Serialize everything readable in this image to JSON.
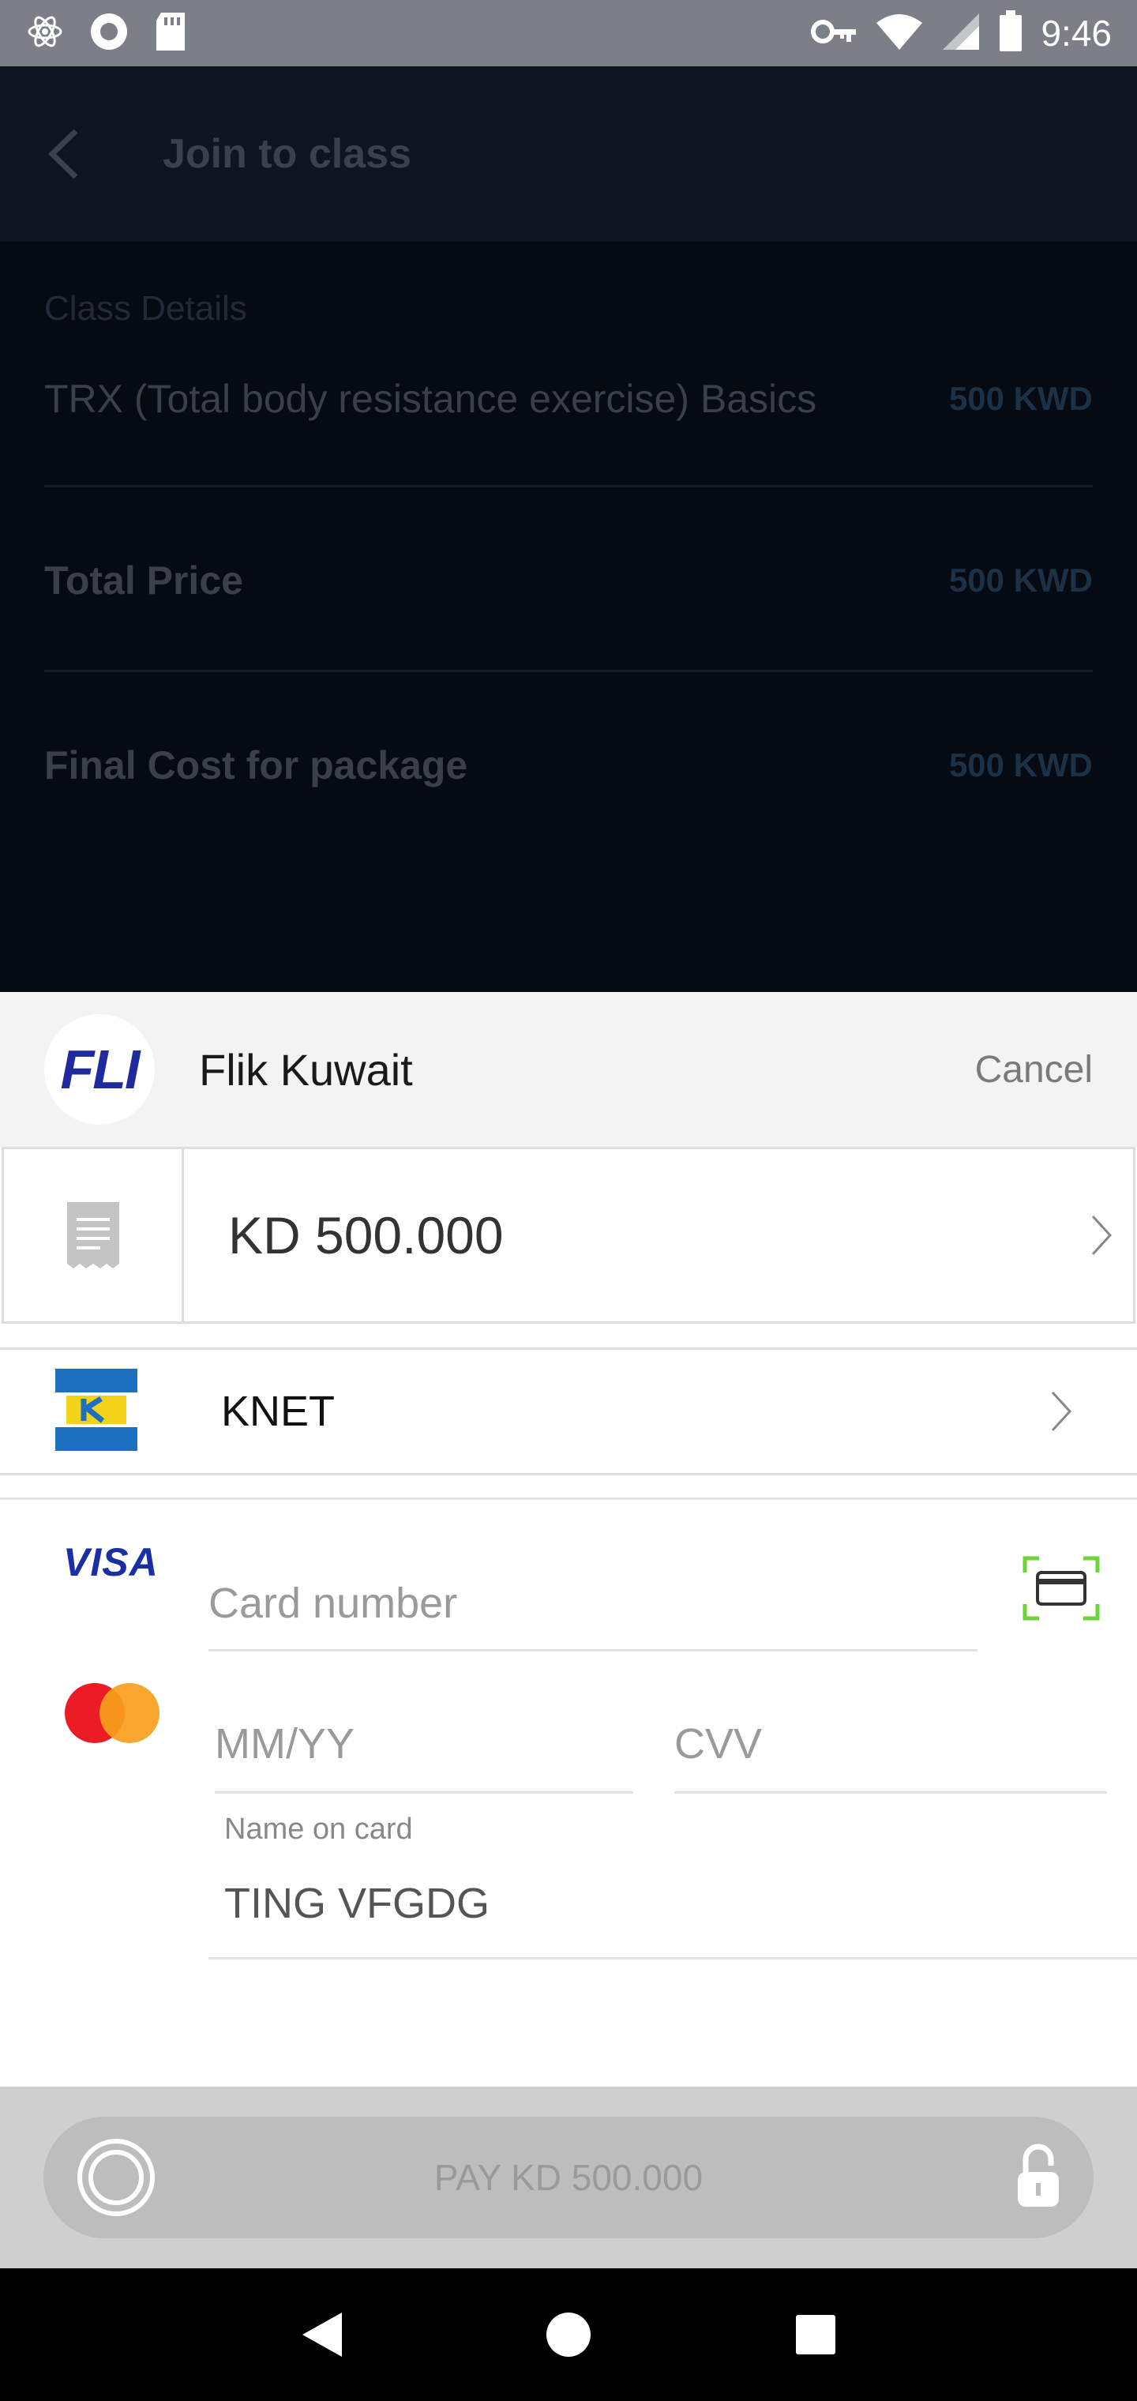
{
  "status_bar": {
    "time": "9:46"
  },
  "header": {
    "title": "Join to class"
  },
  "class_details": {
    "section_title": "Class Details",
    "class_name": "TRX (Total body resistance exercise) Basics",
    "class_price": "500 KWD",
    "total_label": "Total Price",
    "total_price": "500 KWD",
    "final_label": "Final Cost for package",
    "final_price": "500 KWD"
  },
  "payment_sheet": {
    "merchant_logo_text": "FLI",
    "merchant_name": "Flik Kuwait",
    "cancel_label": "Cancel",
    "amount": "KD 500.000",
    "knet_label": "KNET",
    "visa_text": "VISA",
    "card_number_placeholder": "Card number",
    "expiry_placeholder": "MM/YY",
    "cvv_placeholder": "CVV",
    "name_label": "Name on card",
    "name_value": "TING VFGDG",
    "pay_label": "PAY KD 500.000"
  },
  "colors": {
    "visa_blue": "#1a2ea6",
    "knet_blue": "#1d6fc0",
    "knet_yellow": "#f3d21a",
    "mastercard_red": "#eb1c26",
    "mastercard_orange": "#f79e1b",
    "scan_green": "#6fd33a"
  }
}
